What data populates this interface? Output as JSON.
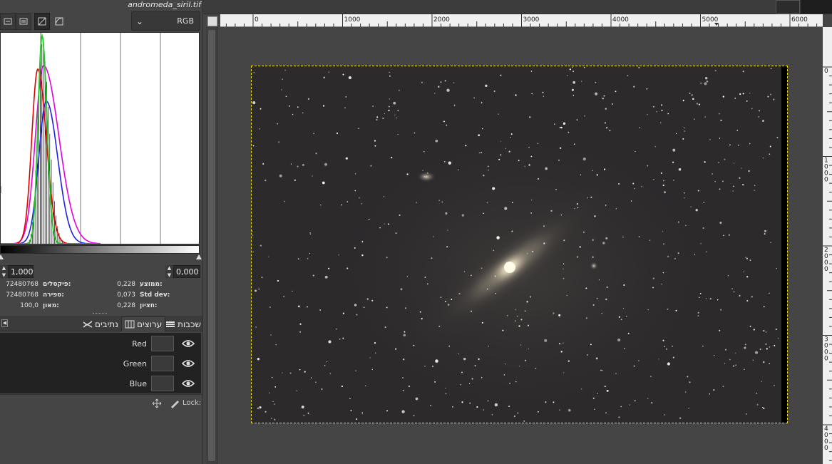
{
  "window": {
    "image_title": "andromeda_siril.tif"
  },
  "histogram": {
    "channel": "RGB",
    "range_low": "1,000",
    "range_high": "0,000",
    "stats": {
      "pixels_label": "פיקסלים:",
      "pixels_value": "72480768",
      "count_label": "ספירה:",
      "count_value": "72480768",
      "percentile_label": "מאון:",
      "percentile_value": "100,0",
      "mean_label": "ממוצע:",
      "mean_value": "0,228",
      "stddev_label": "Std dev:",
      "stddev_value": "0,073",
      "median_label": "חציון:",
      "median_value": "0,228"
    }
  },
  "tabs": {
    "layers": "שכבות",
    "channels": "ערוצים",
    "paths": "נתיבים"
  },
  "channels": [
    {
      "name": "Red"
    },
    {
      "name": "Green"
    },
    {
      "name": "Blue"
    }
  ],
  "lock": {
    "label": "Lock:"
  },
  "ruler": {
    "h_ticks": [
      "0",
      "1000",
      "2000",
      "3000",
      "4000",
      "5000",
      "6000"
    ],
    "v_ticks": [
      "0",
      "1000",
      "2000",
      "3000",
      "4000"
    ]
  },
  "colors": {
    "selection": "#f2e400",
    "sky": "#2a2829",
    "red": "#e00000",
    "green": "#1ec81e",
    "blue": "#2020e6",
    "magenta": "#e000e0"
  }
}
